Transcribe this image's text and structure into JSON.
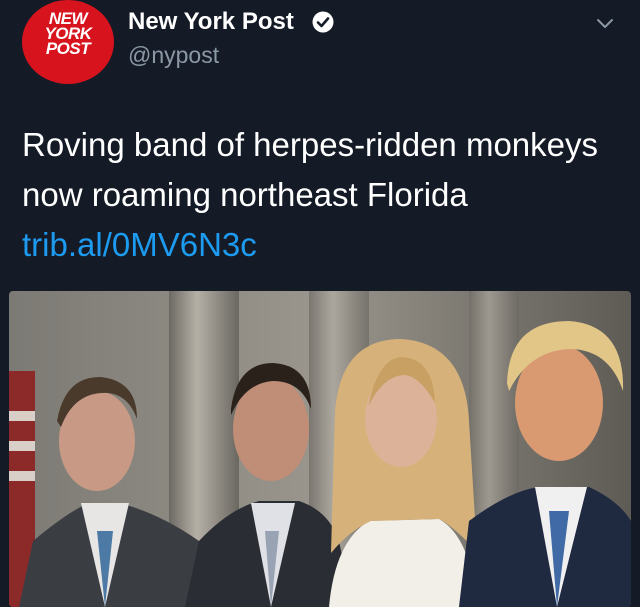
{
  "account": {
    "avatar_text": [
      "NEW",
      "YORK",
      "POST"
    ],
    "display_name": "New York Post",
    "handle": "@nypost",
    "verified": true
  },
  "tweet": {
    "text": "Roving band of herpes-ridden monkeys now roaming northeast Florida ",
    "link": "trib.al/0MV6N3c"
  },
  "icons": {
    "verified": "verified-badge-icon",
    "menu": "chevron-down-icon"
  },
  "colors": {
    "background": "#141b26",
    "avatar_red": "#d7141e",
    "link": "#1d9bf0",
    "secondary_text": "#8b98a5"
  }
}
